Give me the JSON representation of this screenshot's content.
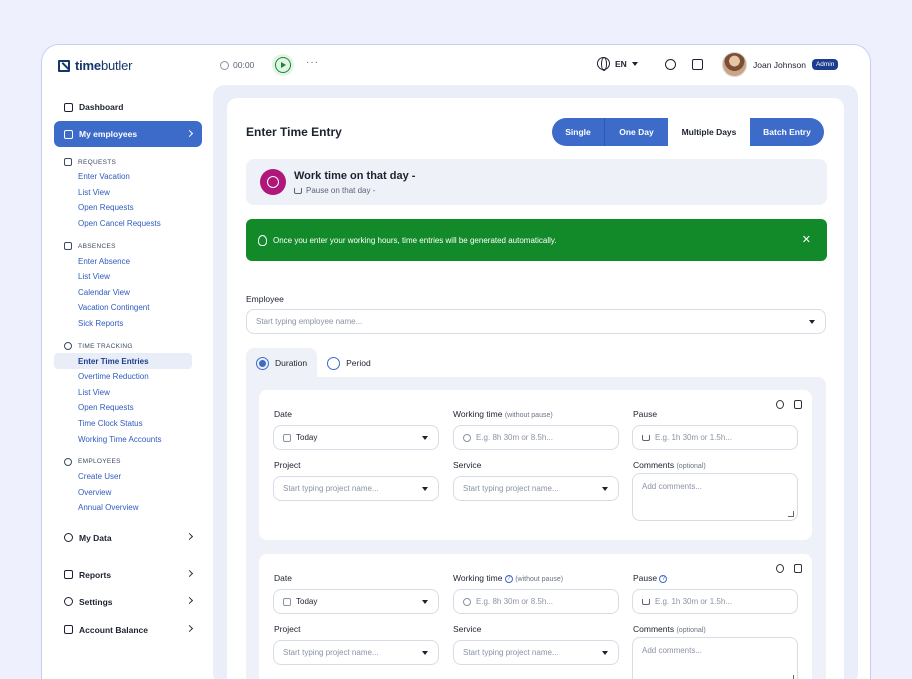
{
  "header": {
    "logo_bold": "time",
    "logo_rest": "butler",
    "timer": "00:00",
    "more": "···",
    "language": "EN",
    "user_name": "Joan Johnson",
    "user_role": "Admin"
  },
  "sidebar": {
    "dashboard": "Dashboard",
    "my_employees": "My employees",
    "requests": {
      "title": "REQUESTS",
      "items": [
        "Enter Vacation",
        "List View",
        "Open Requests",
        "Open Cancel Requests"
      ]
    },
    "absences": {
      "title": "ABSENCES",
      "items": [
        "Enter Absence",
        "List View",
        "Calendar View",
        "Vacation Contingent",
        "Sick Reports"
      ]
    },
    "time_tracking": {
      "title": "TIME TRACKING",
      "items": [
        "Enter Time Entries",
        "Overtime Reduction",
        "List View",
        "Open Requests",
        "Time Clock Status",
        "Working Time Accounts"
      ]
    },
    "employees": {
      "title": "EMPLOYEES",
      "items": [
        "Create User",
        "Overview",
        "Annual Overview"
      ]
    },
    "my_data": "My Data",
    "reports": "Reports",
    "settings": "Settings",
    "account_balance": "Account Balance"
  },
  "main": {
    "title": "Enter Time Entry",
    "modes": [
      "Single",
      "One Day",
      "Multiple Days",
      "Batch Entry"
    ],
    "active_mode": "Multiple Days",
    "work_title": "Work time on that day -",
    "work_sub": "Pause on that day -",
    "alert": "Once you enter your working hours, time entries will be generated automatically.",
    "employee_label": "Employee",
    "employee_placeholder": "Start typing employee name...",
    "tab_duration": "Duration",
    "tab_period": "Period",
    "entry": {
      "date_label": "Date",
      "date_value": "Today",
      "working_label": "Working time",
      "working_hint": "(without pause)",
      "working_placeholder": "E.g. 8h 30m or 8.5h...",
      "pause_label": "Pause",
      "pause_placeholder": "E.g. 1h 30m or 1.5h...",
      "project_label": "Project",
      "project_placeholder": "Start typing project name...",
      "service_label": "Service",
      "service_placeholder": "Start typing project name...",
      "comments_label": "Comments",
      "comments_hint": "(optional)",
      "comments_placeholder": "Add comments..."
    }
  },
  "colors": {
    "primary": "#3d6bc9",
    "success": "#138a2a",
    "accent": "#b0177a",
    "brand": "#14366b"
  }
}
